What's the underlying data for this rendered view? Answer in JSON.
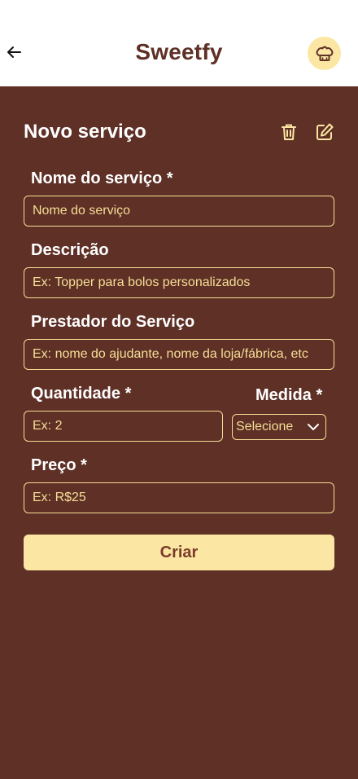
{
  "header": {
    "title": "Sweetfy",
    "back_icon": "arrow-left-icon",
    "avatar_icon": "chef-hat-icon"
  },
  "form": {
    "title": "Novo serviço",
    "delete_icon": "trash-icon",
    "edit_icon": "edit-icon",
    "fields": {
      "name": {
        "label": "Nome do serviço *",
        "placeholder": "Nome do serviço"
      },
      "description": {
        "label": "Descrição",
        "placeholder": "Ex: Topper para bolos personalizados"
      },
      "provider": {
        "label": "Prestador do Serviço",
        "placeholder": "Ex: nome do ajudante, nome da loja/fábrica, etc"
      },
      "quantity": {
        "label": "Quantidade *",
        "placeholder": "Ex: 2"
      },
      "measure": {
        "label": "Medida *",
        "selected": "Selecione"
      },
      "price": {
        "label": "Preço *",
        "placeholder": "Ex: R$25"
      }
    },
    "submit_label": "Criar"
  },
  "colors": {
    "background": "#5e3026",
    "accent": "#fbe7a3",
    "field_border": "#f6df96"
  }
}
